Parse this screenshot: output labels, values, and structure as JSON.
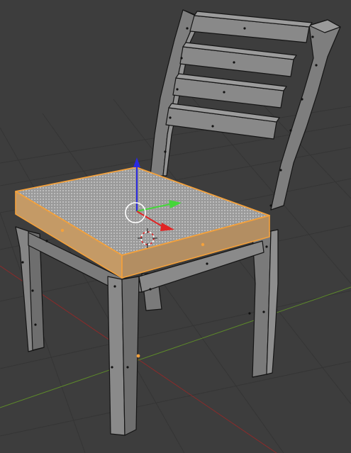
{
  "viewport": {
    "background": "#3d3d3d",
    "grid_color": "#353535",
    "x_axis_color": "#8b2a2a",
    "y_axis_color": "#5d8a2a"
  },
  "scene": {
    "object": "chair",
    "mesh_face_color": "#8c8c8c",
    "mesh_edge_color": "#141414",
    "selection_color": "#f4a13b",
    "selected_part": "seat",
    "edit_mode_vertices": true
  },
  "gizmo": {
    "x_axis_color": "#e02424",
    "y_axis_color": "#45d63a",
    "z_axis_color": "#2a2ae0",
    "center_ring_color": "#ffffff"
  },
  "cursor_3d": {
    "ring_color_a": "#e02424",
    "ring_color_b": "#ffffff"
  }
}
